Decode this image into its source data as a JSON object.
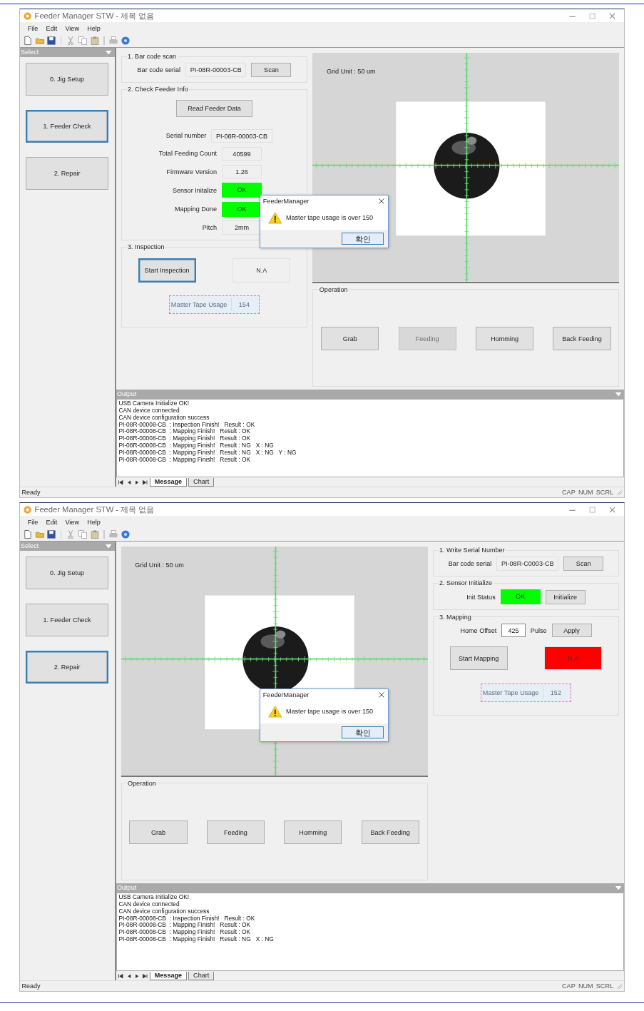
{
  "windows": [
    {
      "title": "Feeder Manager STW - 제목 없음",
      "menu": [
        "File",
        "Edit",
        "View",
        "Help"
      ],
      "sidebar": {
        "title": "Select",
        "items": [
          {
            "label": "0. Jig Setup",
            "selected": false
          },
          {
            "label": "1. Feeder Check",
            "selected": true
          },
          {
            "label": "2. Repair",
            "selected": false
          }
        ]
      },
      "columns": [
        [
          {
            "kind": "group",
            "title": "1. Bar code scan",
            "rows": [
              {
                "items": [
                  {
                    "kind": "label",
                    "text": "Bar code serial"
                  },
                  {
                    "kind": "field",
                    "value": "PI-08R-00003-CB"
                  },
                  {
                    "kind": "button",
                    "label": "Scan",
                    "disabled": false,
                    "focused": false
                  }
                ]
              }
            ]
          },
          {
            "kind": "group",
            "title": "2. Check Feeder Info",
            "rows": [
              {
                "items": [
                  {
                    "kind": "button",
                    "label": "Read Feeder Data",
                    "disabled": false,
                    "focused": false
                  }
                ]
              },
              {
                "items": [
                  {
                    "kind": "label",
                    "text": "Serial number"
                  },
                  {
                    "kind": "field",
                    "value": "PI-08R-00003-CB"
                  }
                ]
              },
              {
                "items": [
                  {
                    "kind": "label",
                    "text": "Total Feeding Count"
                  },
                  {
                    "kind": "field",
                    "value": "40599"
                  }
                ]
              },
              {
                "items": [
                  {
                    "kind": "label",
                    "text": "Firmware Version"
                  },
                  {
                    "kind": "field",
                    "value": "1.26"
                  }
                ]
              },
              {
                "items": [
                  {
                    "kind": "label",
                    "text": "Sensor Initalize"
                  },
                  {
                    "kind": "status",
                    "text": "OK",
                    "color": "#00ff00"
                  }
                ]
              },
              {
                "items": [
                  {
                    "kind": "label",
                    "text": "Mapping Done"
                  },
                  {
                    "kind": "status",
                    "text": "OK",
                    "color": "#00ff00"
                  }
                ]
              },
              {
                "items": [
                  {
                    "kind": "label",
                    "text": "Pitch"
                  },
                  {
                    "kind": "field",
                    "value": "2mm"
                  }
                ]
              }
            ]
          },
          {
            "kind": "group",
            "title": "3. Inspection",
            "rows": [
              {
                "items": [
                  {
                    "kind": "button",
                    "label": "Start Inspection",
                    "disabled": false,
                    "focused": true
                  },
                  {
                    "kind": "status",
                    "text": "N.A",
                    "color": "#f0f0f0"
                  }
                ]
              },
              {
                "items": [
                  {
                    "kind": "usage",
                    "label": "Master Tape Usage",
                    "value": "154"
                  }
                ]
              }
            ]
          }
        ],
        [
          {
            "kind": "camera",
            "grid_label": "Grid Unit : 50 um"
          },
          {
            "kind": "group",
            "title": "Operation",
            "rows": [
              {
                "items": [
                  {
                    "kind": "button",
                    "label": "Grab",
                    "disabled": false,
                    "focused": false
                  },
                  {
                    "kind": "button",
                    "label": "Feeding",
                    "disabled": true,
                    "focused": false
                  },
                  {
                    "kind": "button",
                    "label": "Homming",
                    "disabled": false,
                    "focused": false
                  },
                  {
                    "kind": "button",
                    "label": "Back Feeding",
                    "disabled": false,
                    "focused": false
                  }
                ]
              }
            ]
          }
        ]
      ],
      "output": {
        "title": "Output",
        "lines": [
          "USB Camera Initialize OK!",
          "CAN device connected",
          "CAN device configuration success",
          "PI-08R-00008-CB  : Inspection Finish!   Result : OK",
          "PI-08R-00008-CB  : Mapping Finish!   Result : OK",
          "PI-08R-00008-CB  : Mapping Finish!   Result : OK",
          "PI-08R-00008-CB  : Mapping Finish!   Result : NG   X : NG",
          "PI-08R-00008-CB  : Mapping Finish!   Result : NG   X : NG   Y : NG",
          "PI-08R-00008-CB  : Mapping Finish!   Result : OK"
        ]
      },
      "output_tabs": [
        {
          "label": "Message",
          "selected": true
        },
        {
          "label": "Chart",
          "selected": false
        }
      ],
      "status_bar": {
        "text": "Ready",
        "indicators": [
          "CAP",
          "NUM",
          "SCRL"
        ]
      },
      "dialog": {
        "title": "FeederManager",
        "message": "Master tape usage is over 150",
        "button": "확인"
      }
    },
    {
      "title": "Feeder Manager STW - 제목 없음",
      "menu": [
        "File",
        "Edit",
        "View",
        "Help"
      ],
      "sidebar": {
        "title": "Select",
        "items": [
          {
            "label": "0. Jig Setup",
            "selected": false
          },
          {
            "label": "1. Feeder Check",
            "selected": false
          },
          {
            "label": "2. Repair",
            "selected": true
          }
        ]
      },
      "columns": [
        [
          {
            "kind": "camera",
            "grid_label": "Grid Unit : 50 um"
          },
          {
            "kind": "group",
            "title": "Operation",
            "rows": [
              {
                "items": [
                  {
                    "kind": "button",
                    "label": "Grab",
                    "disabled": false,
                    "focused": false
                  },
                  {
                    "kind": "button",
                    "label": "Feeding",
                    "disabled": false,
                    "focused": false
                  },
                  {
                    "kind": "button",
                    "label": "Homming",
                    "disabled": false,
                    "focused": false
                  },
                  {
                    "kind": "button",
                    "label": "Back Feeding",
                    "disabled": false,
                    "focused": false
                  }
                ]
              }
            ]
          }
        ],
        [
          {
            "kind": "group",
            "title": "1. Write Serial Number",
            "rows": [
              {
                "items": [
                  {
                    "kind": "label",
                    "text": "Bar code serial"
                  },
                  {
                    "kind": "field",
                    "value": "PI-08R-C0003-CB"
                  },
                  {
                    "kind": "button",
                    "label": "Scan",
                    "disabled": false,
                    "focused": false
                  }
                ]
              }
            ]
          },
          {
            "kind": "group",
            "title": "2. Sensor Initialize",
            "rows": [
              {
                "items": [
                  {
                    "kind": "label",
                    "text": "Init Status"
                  },
                  {
                    "kind": "status",
                    "text": "OK",
                    "color": "#00ff00"
                  },
                  {
                    "kind": "button",
                    "label": "Initialize",
                    "disabled": false,
                    "focused": false
                  }
                ]
              }
            ]
          },
          {
            "kind": "group",
            "title": "3. Mapping",
            "rows": [
              {
                "items": [
                  {
                    "kind": "label",
                    "text": "Home Offset"
                  },
                  {
                    "kind": "input",
                    "value": "425"
                  },
                  {
                    "kind": "label",
                    "text": "Pulse"
                  },
                  {
                    "kind": "button",
                    "label": "Apply",
                    "disabled": false,
                    "focused": false
                  }
                ]
              },
              {
                "items": [
                  {
                    "kind": "button",
                    "label": "Start Mapping",
                    "disabled": false,
                    "focused": false
                  },
                  {
                    "kind": "status",
                    "text": "N.A",
                    "color": "#ff0000"
                  }
                ]
              },
              {
                "items": [
                  {
                    "kind": "usage",
                    "label": "Master Tape Usage",
                    "value": "152"
                  }
                ]
              }
            ]
          }
        ]
      ],
      "output": {
        "title": "Output",
        "lines": [
          "USB Camera Initialize OK!",
          "CAN device connected",
          "CAN device configuration success",
          "PI-08R-00008-CB  : Inspection Finish!   Result : OK",
          "PI-08R-00008-CB  : Mapping Finish!   Result : OK",
          "PI-08R-00008-CB  : Mapping Finish!   Result : OK",
          "PI-08R-00008-CB  : Mapping Finish!   Result : NG   X : NG"
        ]
      },
      "output_tabs": [
        {
          "label": "Message",
          "selected": true
        },
        {
          "label": "Chart",
          "selected": false
        }
      ],
      "status_bar": {
        "text": "Ready",
        "indicators": [
          "CAP",
          "NUM",
          "SCRL"
        ]
      },
      "dialog": {
        "title": "FeederManager",
        "message": "Master tape usage is over 150",
        "button": "확인"
      }
    }
  ]
}
